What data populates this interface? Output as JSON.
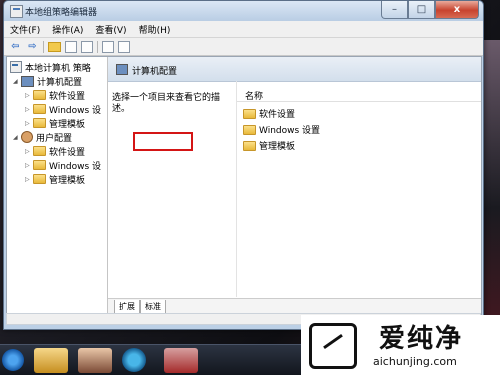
{
  "window": {
    "title": "本地组策略编辑器",
    "buttons": {
      "min": "–",
      "max": "□",
      "close": "x"
    }
  },
  "menu": [
    "文件(F)",
    "操作(A)",
    "查看(V)",
    "帮助(H)"
  ],
  "tree": {
    "root": "本地计算机 策略",
    "computer_config": "计算机配置",
    "computer_children": [
      "软件设置",
      "Windows 设",
      "管理模板"
    ],
    "user_config": "用户配置",
    "user_children": [
      "软件设置",
      "Windows 设",
      "管理模板"
    ]
  },
  "right_pane": {
    "header_title": "计算机配置",
    "description": "选择一个项目来查看它的描述。",
    "column_header": "名称",
    "items": [
      "软件设置",
      "Windows 设置",
      "管理模板"
    ],
    "highlighted_item": "管理模板"
  },
  "tabs": [
    "扩展",
    "标准"
  ],
  "watermark": {
    "brand": "爱纯净",
    "url": "aichunjing.com"
  },
  "colors": {
    "highlight": "#d41515",
    "folder": "#f2c94c",
    "titlebar": "#b9cde4"
  }
}
